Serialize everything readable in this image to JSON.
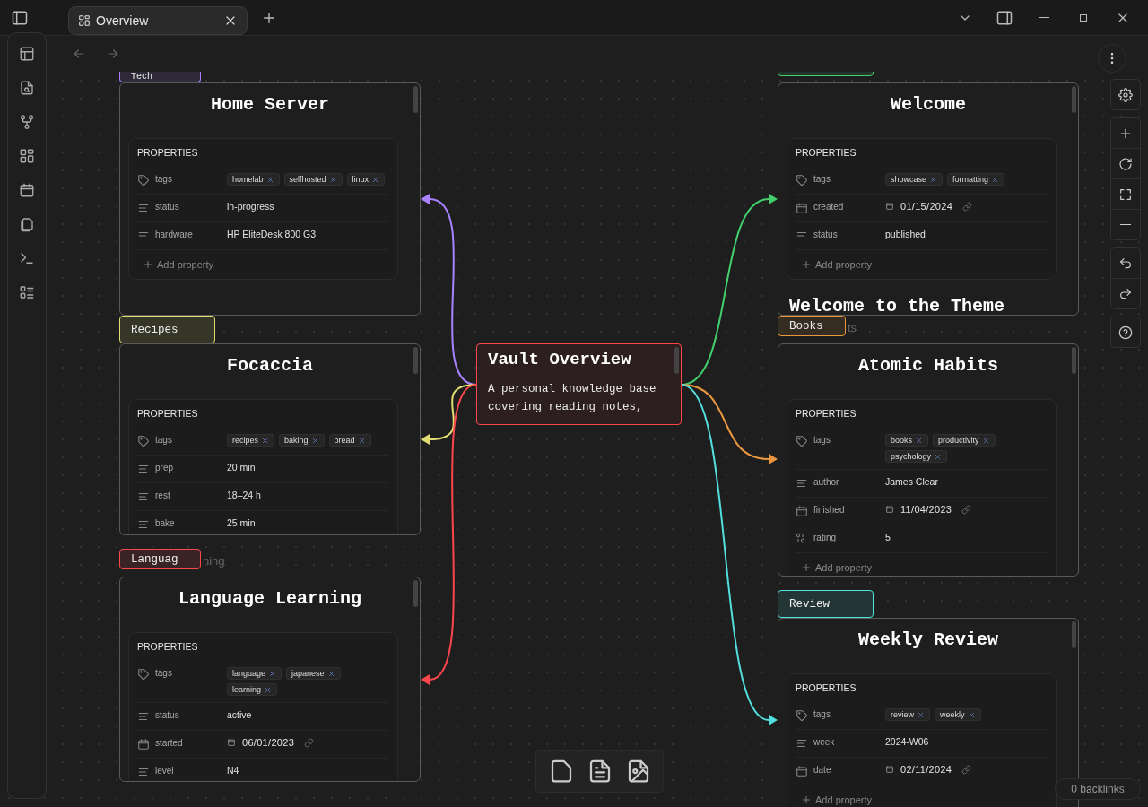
{
  "tab": {
    "title": "Overview",
    "selected": true
  },
  "center_node": {
    "title": "Vault Overview",
    "text": "A personal knowledge base covering reading notes,",
    "color": "#fb464c"
  },
  "cards": [
    {
      "group": {
        "label": "Tech",
        "color": "#a882ff"
      },
      "title": "Home Server",
      "edge": {
        "color": "#a882ff"
      },
      "properties_heading": "PROPERTIES",
      "properties": [
        {
          "kind": "tags",
          "name": "tags",
          "tags": [
            "homelab",
            "selfhosted",
            "linux"
          ]
        },
        {
          "kind": "text",
          "name": "status",
          "value": "in-progress"
        },
        {
          "kind": "text",
          "name": "hardware",
          "value": "HP EliteDesk 800 G3"
        }
      ],
      "add_property": "Add property"
    },
    {
      "group": {
        "label": "Recipes",
        "color": "#e0de71"
      },
      "title": "Focaccia",
      "edge": {
        "color": "#e0de71"
      },
      "properties_heading": "PROPERTIES",
      "properties": [
        {
          "kind": "tags",
          "name": "tags",
          "tags": [
            "recipes",
            "baking",
            "bread"
          ]
        },
        {
          "kind": "text",
          "name": "prep",
          "value": "20 min"
        },
        {
          "kind": "text",
          "name": "rest",
          "value": "18–24 h"
        },
        {
          "kind": "text",
          "name": "bake",
          "value": "25 min"
        }
      ]
    },
    {
      "group": {
        "label": "Languag",
        "color": "#fb464c",
        "ghost": "ning"
      },
      "title": "Language Learning",
      "edge": {
        "color": "#fb464c"
      },
      "properties_heading": "PROPERTIES",
      "properties": [
        {
          "kind": "tags",
          "name": "tags",
          "tags": [
            "language",
            "japanese",
            "learning"
          ]
        },
        {
          "kind": "text",
          "name": "status",
          "value": "active"
        },
        {
          "kind": "date",
          "name": "started",
          "value": "06/01/2023"
        },
        {
          "kind": "text",
          "name": "level",
          "value": "N4"
        }
      ]
    },
    {
      "group": {
        "color": "#44cf6e"
      },
      "title": "Welcome",
      "edge": {
        "color": "#44cf6e"
      },
      "properties_heading": "PROPERTIES",
      "properties": [
        {
          "kind": "tags",
          "name": "tags",
          "tags": [
            "showcase",
            "formatting"
          ]
        },
        {
          "kind": "date",
          "name": "created",
          "value": "01/15/2024"
        },
        {
          "kind": "text",
          "name": "status",
          "value": "published"
        }
      ],
      "add_property": "Add property",
      "heading": "Welcome to the Theme"
    },
    {
      "group": {
        "label": "Books",
        "color": "#e9973f",
        "ghost": "ts"
      },
      "title": "Atomic Habits",
      "edge": {
        "color": "#e9973f"
      },
      "properties_heading": "PROPERTIES",
      "properties": [
        {
          "kind": "tags",
          "name": "tags",
          "tags": [
            "books",
            "productivity",
            "psychology"
          ]
        },
        {
          "kind": "text",
          "name": "author",
          "value": "James Clear"
        },
        {
          "kind": "date",
          "name": "finished",
          "value": "11/04/2023"
        },
        {
          "kind": "number",
          "name": "rating",
          "value": "5"
        }
      ],
      "add_property": "Add property"
    },
    {
      "group": {
        "label": "Review",
        "color": "#53dfdd"
      },
      "title": "Weekly Review",
      "edge": {
        "color": "#53dfdd"
      },
      "properties_heading": "PROPERTIES",
      "properties": [
        {
          "kind": "tags",
          "name": "tags",
          "tags": [
            "review",
            "weekly"
          ]
        },
        {
          "kind": "text",
          "name": "week",
          "value": "2024-W06"
        },
        {
          "kind": "date",
          "name": "date",
          "value": "02/11/2024"
        }
      ],
      "add_property": "Add property"
    }
  ],
  "backlinks": "0 backlinks"
}
